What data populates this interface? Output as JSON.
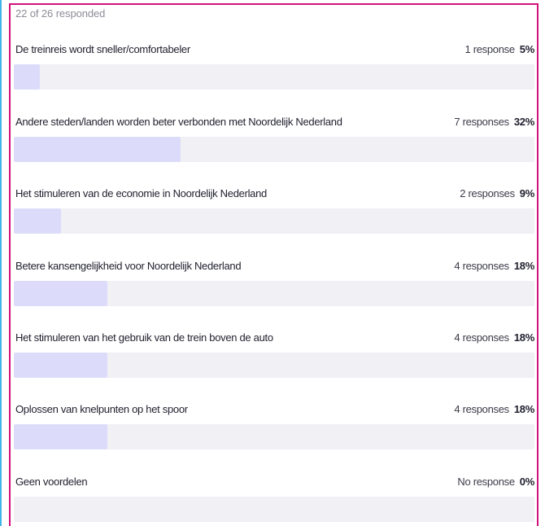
{
  "summary": "22 of 26 responded",
  "colors": {
    "bar_fill": "#dcdcfa",
    "bar_track": "#f0f0f5",
    "panel_border": "#d0127a",
    "left_edge": "#3fb6e8"
  },
  "options": [
    {
      "label": "De treinreis wordt sneller/comfortabeler",
      "count": "1 response",
      "percent": "5%",
      "fraction": 0.05
    },
    {
      "label": "Andere steden/landen worden beter verbonden met Noordelijk Nederland",
      "count": "7 responses",
      "percent": "32%",
      "fraction": 0.32
    },
    {
      "label": "Het stimuleren van de economie in Noordelijk Nederland",
      "count": "2 responses",
      "percent": "9%",
      "fraction": 0.09
    },
    {
      "label": "Betere kansengelijkheid voor Noordelijk Nederland",
      "count": "4 responses",
      "percent": "18%",
      "fraction": 0.18
    },
    {
      "label": "Het stimuleren van het gebruik van de trein boven de auto",
      "count": "4 responses",
      "percent": "18%",
      "fraction": 0.18
    },
    {
      "label": "Oplossen van knelpunten op het spoor",
      "count": "4 responses",
      "percent": "18%",
      "fraction": 0.18
    },
    {
      "label": "Geen voordelen",
      "count": "No response",
      "percent": "0%",
      "fraction": 0.0
    }
  ]
}
